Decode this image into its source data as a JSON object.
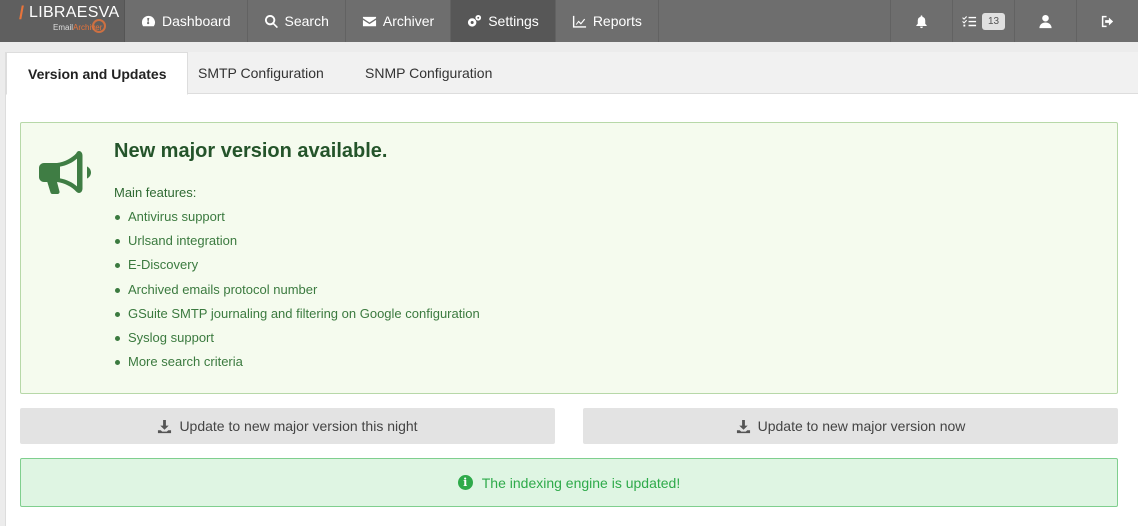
{
  "brand": {
    "name": "LIBRAESVA",
    "sub_prefix": "Email",
    "sub_accent": "Archiver"
  },
  "nav": {
    "items": [
      {
        "label": "Dashboard",
        "icon": "dashboard-icon"
      },
      {
        "label": "Search",
        "icon": "search-icon"
      },
      {
        "label": "Archiver",
        "icon": "envelope-icon"
      },
      {
        "label": "Settings",
        "icon": "gears-icon",
        "active": true
      },
      {
        "label": "Reports",
        "icon": "chart-icon"
      }
    ],
    "tasks_count": "13"
  },
  "tabs": [
    "Version and Updates",
    "SMTP Configuration",
    "SNMP Configuration"
  ],
  "alert": {
    "title": "New major version available.",
    "features_label": "Main features:",
    "features": [
      "Antivirus support",
      "Urlsand integration",
      "E-Discovery",
      "Archived emails protocol number",
      "GSuite SMTP journaling and filtering on Google configuration",
      "Syslog support",
      "More search criteria"
    ]
  },
  "buttons": {
    "update_night": "Update to new major version this night",
    "update_now": "Update to new major version now"
  },
  "status": {
    "message": "The indexing engine is updated!"
  },
  "colors": {
    "accent": "#e8743b",
    "navbar": "#6e6e6e",
    "success": "#2eaa4a",
    "alert_title": "#24542a"
  }
}
